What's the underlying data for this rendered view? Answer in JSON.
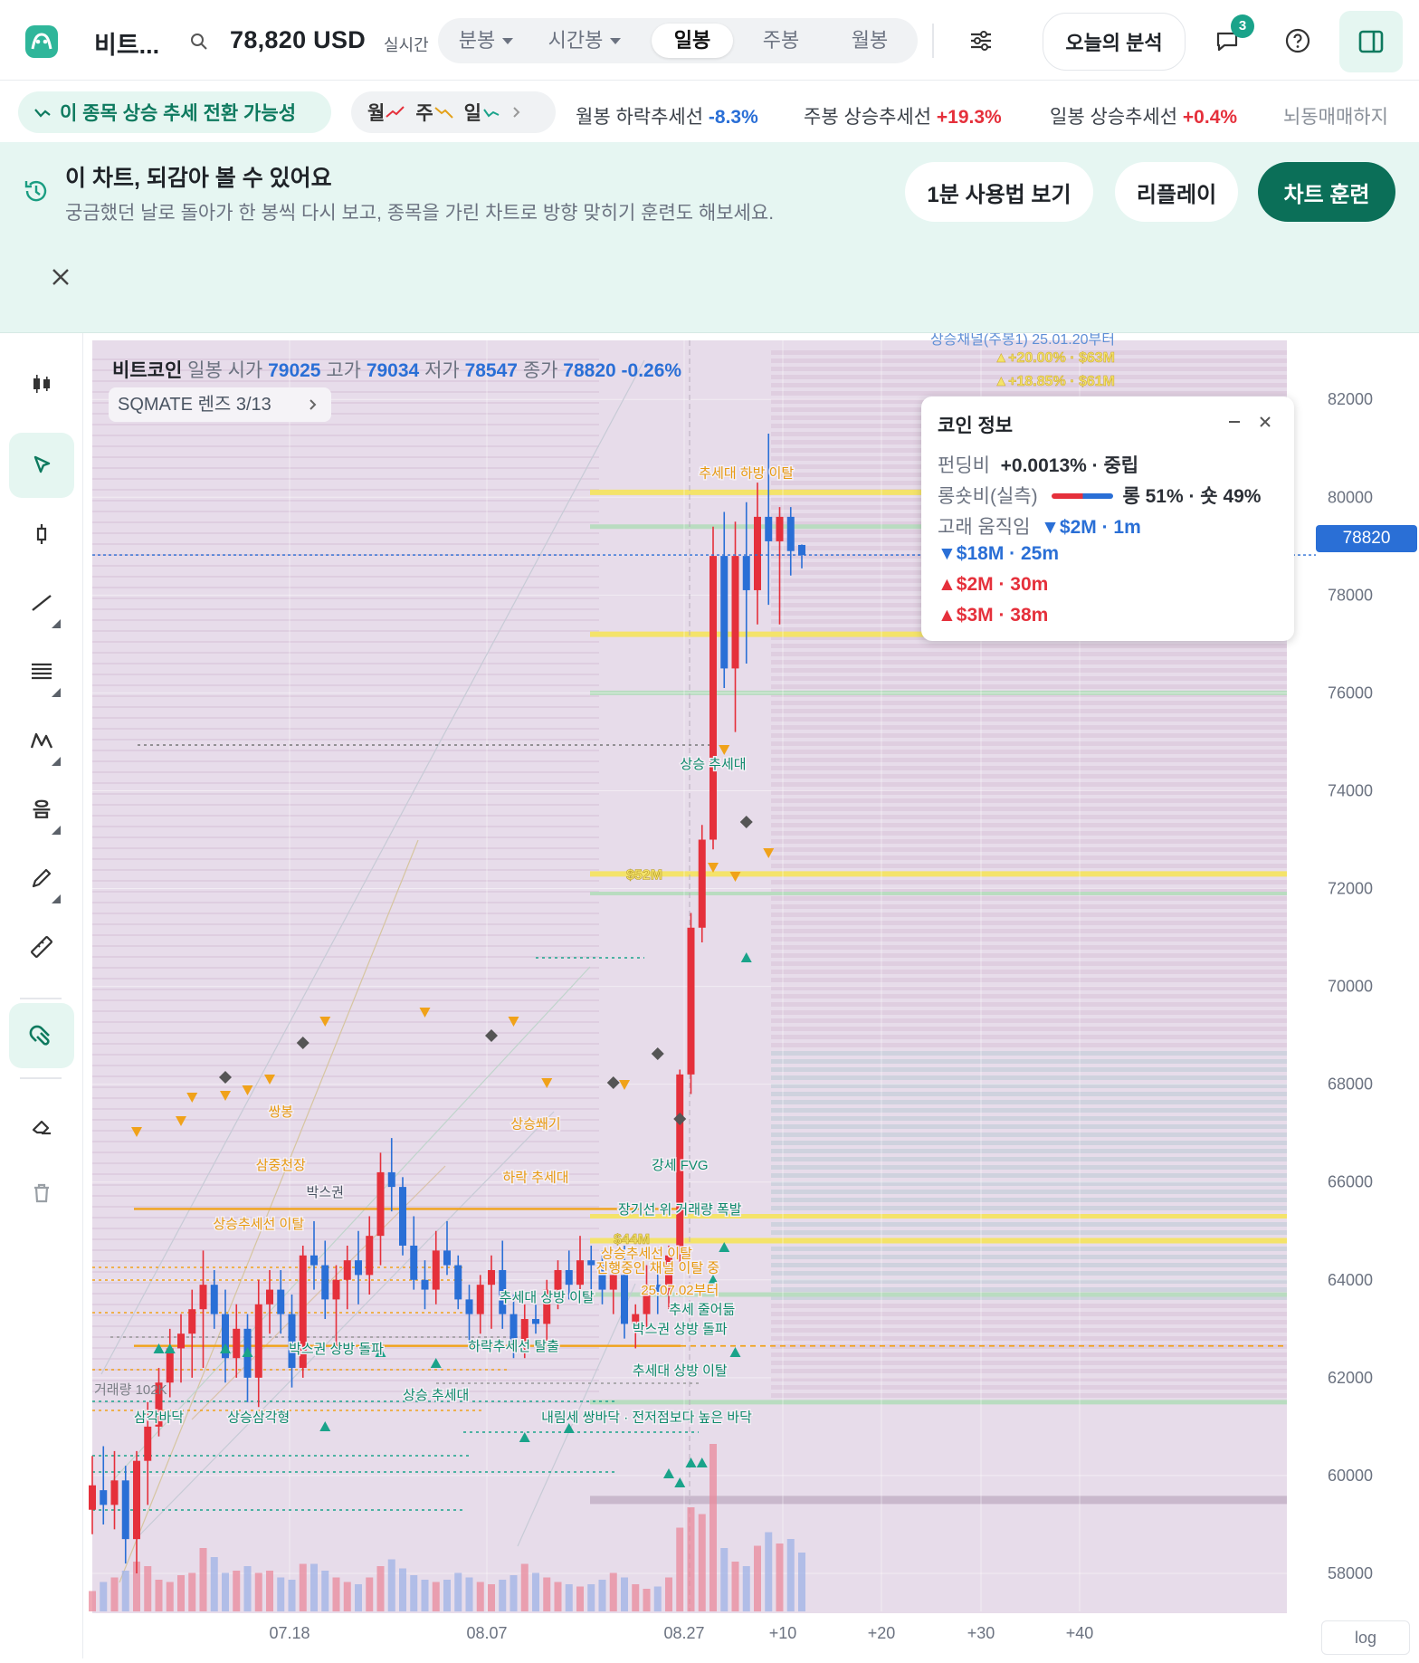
{
  "header": {
    "coin_name": "비트...",
    "price": "78,820 USD",
    "realtime": "실시간",
    "timeframes": [
      {
        "label": "분봉",
        "dropdown": true
      },
      {
        "label": "시간봉",
        "dropdown": true
      },
      {
        "label": "일봉",
        "dropdown": false,
        "active": true
      },
      {
        "label": "주봉",
        "dropdown": false
      },
      {
        "label": "월봉",
        "dropdown": false
      }
    ],
    "today_analysis": "오늘의 분석",
    "notification_count": "3"
  },
  "signals": {
    "trend_pill": "이 종목 상승 추세 전환 가능성",
    "mtf": {
      "m": "월",
      "w": "주",
      "d": "일"
    },
    "ticker": [
      {
        "text": "월봉 하락추세선",
        "value": "-8.3%"
      },
      {
        "text": "주봉 상승추세선",
        "value": "+19.3%"
      },
      {
        "text": "일봉 상승추세선",
        "value": "+0.4%"
      },
      {
        "text": "뇌동매매하지",
        "value": ""
      }
    ]
  },
  "banner": {
    "title": "이 차트, 되감아 볼 수 있어요",
    "subtitle": "궁금했던 날로 돌아가 한 봉씩 다시 보고, 종목을 가린 차트로 방향 맞히기 훈련도 해보세요.",
    "guide_button": "1분 사용법 보기",
    "replay_button": "리플레이",
    "training_button": "차트 훈련"
  },
  "chart_header": {
    "name": "비트코인",
    "interval": "일봉",
    "open_label": "시가",
    "open": "79025",
    "high_label": "고가",
    "high": "79034",
    "low_label": "저가",
    "low": "78547",
    "close_label": "종가",
    "close": "78820",
    "change": "-0.26%",
    "lens": "SQMATE 렌즈  3/13"
  },
  "coin_info": {
    "title": "코인 정보",
    "funding_label": "펀딩비",
    "funding": "+0.0013% · 중립",
    "ls_label": "롱숏비(실측)",
    "ls": "롱 51% · 숏 49%",
    "whale_label": "고래 움직임",
    "whale": [
      "▼$2M · 1m",
      "▼$18M · 25m",
      "▲$2M · 30m",
      "▲$3M · 38m"
    ]
  },
  "current_price_label": "78820",
  "log_label": "log",
  "chart_data": {
    "type": "candlestick",
    "y_ticks": [
      "82000",
      "80000",
      "78000",
      "76000",
      "74000",
      "72000",
      "70000",
      "68000",
      "66000",
      "64000",
      "62000",
      "60000",
      "58000"
    ],
    "x_ticks": [
      "07.18",
      "08.07",
      "08.27",
      "+10",
      "+20",
      "+30",
      "+40"
    ],
    "ylim": [
      57000,
      82800
    ],
    "volume_label": "거래량 102K",
    "channel_label": "상승채널(주봉1) 25.01.20부터",
    "channel_values": [
      "▲+20.00% · $63M",
      "▲+18.85% · $61M"
    ],
    "liquidity_labels": [
      {
        "text": "$52M",
        "price": 72300
      },
      {
        "text": "$44M",
        "price": 64850
      }
    ],
    "annotations": [
      {
        "text": "추세대 하방 이탈",
        "price": 80400,
        "i": 59,
        "color": "orange"
      },
      {
        "text": "상승 추세대",
        "price": 74450,
        "i": 56,
        "color": "green"
      },
      {
        "text": "쌍봉",
        "price": 67350,
        "i": 17,
        "color": "orange"
      },
      {
        "text": "삼중천장",
        "price": 66250,
        "i": 17,
        "color": "orange"
      },
      {
        "text": "박스권",
        "price": 65700,
        "i": 21,
        "color": "dark"
      },
      {
        "text": "상승추세선 이탈",
        "price": 65050,
        "i": 15,
        "color": "orange"
      },
      {
        "text": "상승쐐기",
        "price": 67100,
        "i": 40,
        "color": "orange"
      },
      {
        "text": "하락 추세대",
        "price": 66000,
        "i": 40,
        "color": "orange"
      },
      {
        "text": "강세 FVG",
        "price": 66250,
        "i": 53,
        "color": "green"
      },
      {
        "text": "장기선 위 거래량 폭발",
        "price": 65350,
        "i": 53,
        "color": "green"
      },
      {
        "text": "상승추세선 이탈",
        "price": 64450,
        "i": 50,
        "color": "orange"
      },
      {
        "text": "진행중인 채널 이탈 중",
        "price": 64150,
        "i": 51,
        "color": "orange"
      },
      {
        "text": "25.07.02부터",
        "price": 63700,
        "i": 53,
        "color": "orange"
      },
      {
        "text": "추세대 상방 이탈",
        "price": 63550,
        "i": 41,
        "color": "green"
      },
      {
        "text": "추세 줄어듦",
        "price": 63300,
        "i": 55,
        "color": "green"
      },
      {
        "text": "박스권 상방 돌파",
        "price": 62900,
        "i": 53,
        "color": "green"
      },
      {
        "text": "박스권 상방 돌파",
        "price": 62500,
        "i": 22,
        "color": "green"
      },
      {
        "text": "하락추세선 탈출",
        "price": 62550,
        "i": 38,
        "color": "green"
      },
      {
        "text": "추세대 상방 이탈",
        "price": 62050,
        "i": 53,
        "color": "green"
      },
      {
        "text": "상승 추세대",
        "price": 61550,
        "i": 31,
        "color": "green"
      },
      {
        "text": "삼각바닥",
        "price": 61100,
        "i": 6,
        "color": "green"
      },
      {
        "text": "상승삼각형",
        "price": 61100,
        "i": 15,
        "color": "green"
      },
      {
        "text": "내림세 쌍바닥 · 전저점보다 높은 바닥",
        "price": 61100,
        "i": 50,
        "color": "green"
      }
    ],
    "candles": [
      {
        "o": 59300,
        "h": 60400,
        "l": 58800,
        "c": 59800
      },
      {
        "o": 59700,
        "h": 60600,
        "l": 59000,
        "c": 59400
      },
      {
        "o": 59400,
        "h": 60500,
        "l": 58900,
        "c": 59900
      },
      {
        "o": 59900,
        "h": 60200,
        "l": 58200,
        "c": 58700
      },
      {
        "o": 58700,
        "h": 60500,
        "l": 58000,
        "c": 60300
      },
      {
        "o": 60300,
        "h": 61500,
        "l": 59400,
        "c": 61000
      },
      {
        "o": 61000,
        "h": 62200,
        "l": 60800,
        "c": 61900
      },
      {
        "o": 61900,
        "h": 63000,
        "l": 61600,
        "c": 62600
      },
      {
        "o": 62600,
        "h": 63300,
        "l": 61900,
        "c": 62900
      },
      {
        "o": 62900,
        "h": 63800,
        "l": 62000,
        "c": 63400
      },
      {
        "o": 63400,
        "h": 64600,
        "l": 62200,
        "c": 63900
      },
      {
        "o": 63900,
        "h": 64200,
        "l": 63000,
        "c": 63300
      },
      {
        "o": 63300,
        "h": 63800,
        "l": 61900,
        "c": 62400
      },
      {
        "o": 62400,
        "h": 63500,
        "l": 62000,
        "c": 63000
      },
      {
        "o": 63000,
        "h": 63300,
        "l": 61500,
        "c": 62000
      },
      {
        "o": 62000,
        "h": 64000,
        "l": 61400,
        "c": 63500
      },
      {
        "o": 63500,
        "h": 64200,
        "l": 62900,
        "c": 63800
      },
      {
        "o": 63800,
        "h": 64200,
        "l": 62900,
        "c": 63300
      },
      {
        "o": 63300,
        "h": 63700,
        "l": 61800,
        "c": 62200
      },
      {
        "o": 62200,
        "h": 64700,
        "l": 62000,
        "c": 64500
      },
      {
        "o": 64500,
        "h": 65200,
        "l": 63800,
        "c": 64300
      },
      {
        "o": 64300,
        "h": 64800,
        "l": 63200,
        "c": 63600
      },
      {
        "o": 63600,
        "h": 64300,
        "l": 62600,
        "c": 64000
      },
      {
        "o": 64000,
        "h": 64700,
        "l": 63400,
        "c": 64400
      },
      {
        "o": 64400,
        "h": 65000,
        "l": 63500,
        "c": 64100
      },
      {
        "o": 64100,
        "h": 65300,
        "l": 63700,
        "c": 64900
      },
      {
        "o": 64900,
        "h": 66600,
        "l": 64300,
        "c": 66200
      },
      {
        "o": 66200,
        "h": 66900,
        "l": 65400,
        "c": 65900
      },
      {
        "o": 65900,
        "h": 66100,
        "l": 64500,
        "c": 64700
      },
      {
        "o": 64700,
        "h": 65300,
        "l": 63800,
        "c": 64000
      },
      {
        "o": 64000,
        "h": 64400,
        "l": 63400,
        "c": 63800
      },
      {
        "o": 63800,
        "h": 65000,
        "l": 63500,
        "c": 64600
      },
      {
        "o": 64600,
        "h": 65200,
        "l": 64100,
        "c": 64300
      },
      {
        "o": 64300,
        "h": 64500,
        "l": 63400,
        "c": 63600
      },
      {
        "o": 63600,
        "h": 63900,
        "l": 62700,
        "c": 63300
      },
      {
        "o": 63300,
        "h": 64100,
        "l": 62900,
        "c": 63900
      },
      {
        "o": 63900,
        "h": 64500,
        "l": 63000,
        "c": 64200
      },
      {
        "o": 64200,
        "h": 64800,
        "l": 63000,
        "c": 63300
      },
      {
        "o": 63300,
        "h": 63700,
        "l": 62400,
        "c": 62600
      },
      {
        "o": 62600,
        "h": 63500,
        "l": 62400,
        "c": 63200
      },
      {
        "o": 63200,
        "h": 63600,
        "l": 62900,
        "c": 63100
      },
      {
        "o": 63100,
        "h": 64000,
        "l": 62700,
        "c": 63800
      },
      {
        "o": 63800,
        "h": 64400,
        "l": 63400,
        "c": 64200
      },
      {
        "o": 64200,
        "h": 64600,
        "l": 63600,
        "c": 63900
      },
      {
        "o": 63900,
        "h": 64900,
        "l": 63700,
        "c": 64400
      },
      {
        "o": 64400,
        "h": 64700,
        "l": 63800,
        "c": 64300
      },
      {
        "o": 64300,
        "h": 64600,
        "l": 63500,
        "c": 63800
      },
      {
        "o": 63800,
        "h": 64300,
        "l": 63300,
        "c": 64100
      },
      {
        "o": 64100,
        "h": 64700,
        "l": 62800,
        "c": 63100
      },
      {
        "o": 63100,
        "h": 63500,
        "l": 62600,
        "c": 63300
      },
      {
        "o": 63300,
        "h": 64300,
        "l": 63000,
        "c": 63900
      },
      {
        "o": 63900,
        "h": 64400,
        "l": 63300,
        "c": 63700
      },
      {
        "o": 63700,
        "h": 64700,
        "l": 63400,
        "c": 64500
      },
      {
        "o": 64500,
        "h": 68300,
        "l": 64300,
        "c": 68200
      },
      {
        "o": 68200,
        "h": 71500,
        "l": 67800,
        "c": 71200
      },
      {
        "o": 71200,
        "h": 73300,
        "l": 70900,
        "c": 73000
      },
      {
        "o": 73000,
        "h": 79400,
        "l": 72800,
        "c": 78800
      },
      {
        "o": 78800,
        "h": 79700,
        "l": 76100,
        "c": 76500
      },
      {
        "o": 76500,
        "h": 79500,
        "l": 75200,
        "c": 78800
      },
      {
        "o": 78800,
        "h": 79900,
        "l": 76600,
        "c": 78100
      },
      {
        "o": 78100,
        "h": 80300,
        "l": 77400,
        "c": 79600
      },
      {
        "o": 79600,
        "h": 81300,
        "l": 77800,
        "c": 79100
      },
      {
        "o": 79100,
        "h": 79800,
        "l": 77400,
        "c": 79600
      },
      {
        "o": 79600,
        "h": 79800,
        "l": 78400,
        "c": 78900
      },
      {
        "o": 79025,
        "h": 79034,
        "l": 78547,
        "c": 78820
      }
    ],
    "volume": [
      18,
      26,
      30,
      36,
      44,
      40,
      28,
      26,
      32,
      34,
      56,
      48,
      34,
      36,
      40,
      34,
      36,
      30,
      28,
      42,
      42,
      36,
      30,
      26,
      24,
      30,
      40,
      46,
      38,
      32,
      28,
      26,
      28,
      34,
      30,
      26,
      24,
      28,
      32,
      42,
      34,
      30,
      26,
      24,
      22,
      24,
      28,
      34,
      30,
      24,
      20,
      22,
      30,
      74,
      92,
      86,
      148,
      56,
      44,
      40,
      58,
      70,
      60,
      64,
      52
    ]
  }
}
